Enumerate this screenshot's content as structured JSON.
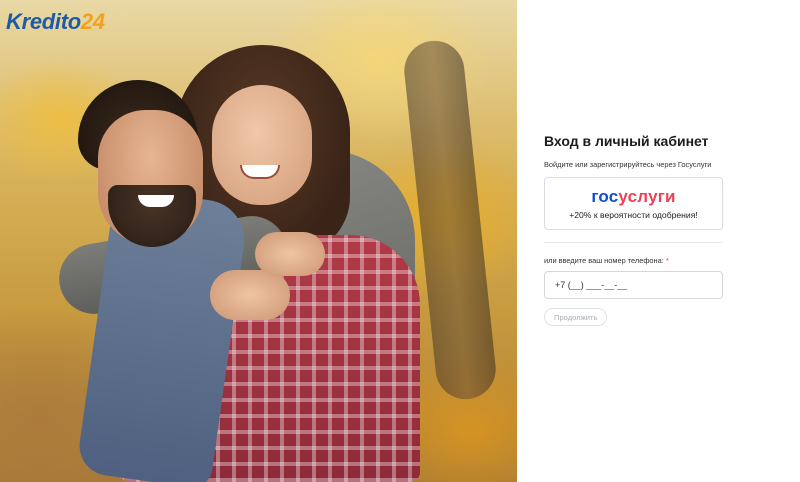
{
  "brand": {
    "logo_main": "Kredito",
    "logo_accent": "24",
    "color_primary": "#1f5aa6",
    "color_accent": "#f2a11f"
  },
  "hero": {
    "image_alt_icon": "couple-photo"
  },
  "login": {
    "title": "Вход в личный кабинет",
    "gosuslugi_prompt": "Войдите или зарегистрируйтесь через Госуслуги",
    "gosuslugi_logo_a": "гос",
    "gosuslugi_logo_b": "услуги",
    "gosuslugi_bonus": "+20% к вероятности одобрения!",
    "phone_label": "или введите ваш номер телефона:",
    "required_mark": "*",
    "phone_placeholder": "+7 (__) ___-__-__",
    "continue_label": "Продолжить",
    "colors": {
      "gos_blue": "#0d4cd3",
      "gos_red": "#ee3f58",
      "required": "#e0453a"
    }
  }
}
